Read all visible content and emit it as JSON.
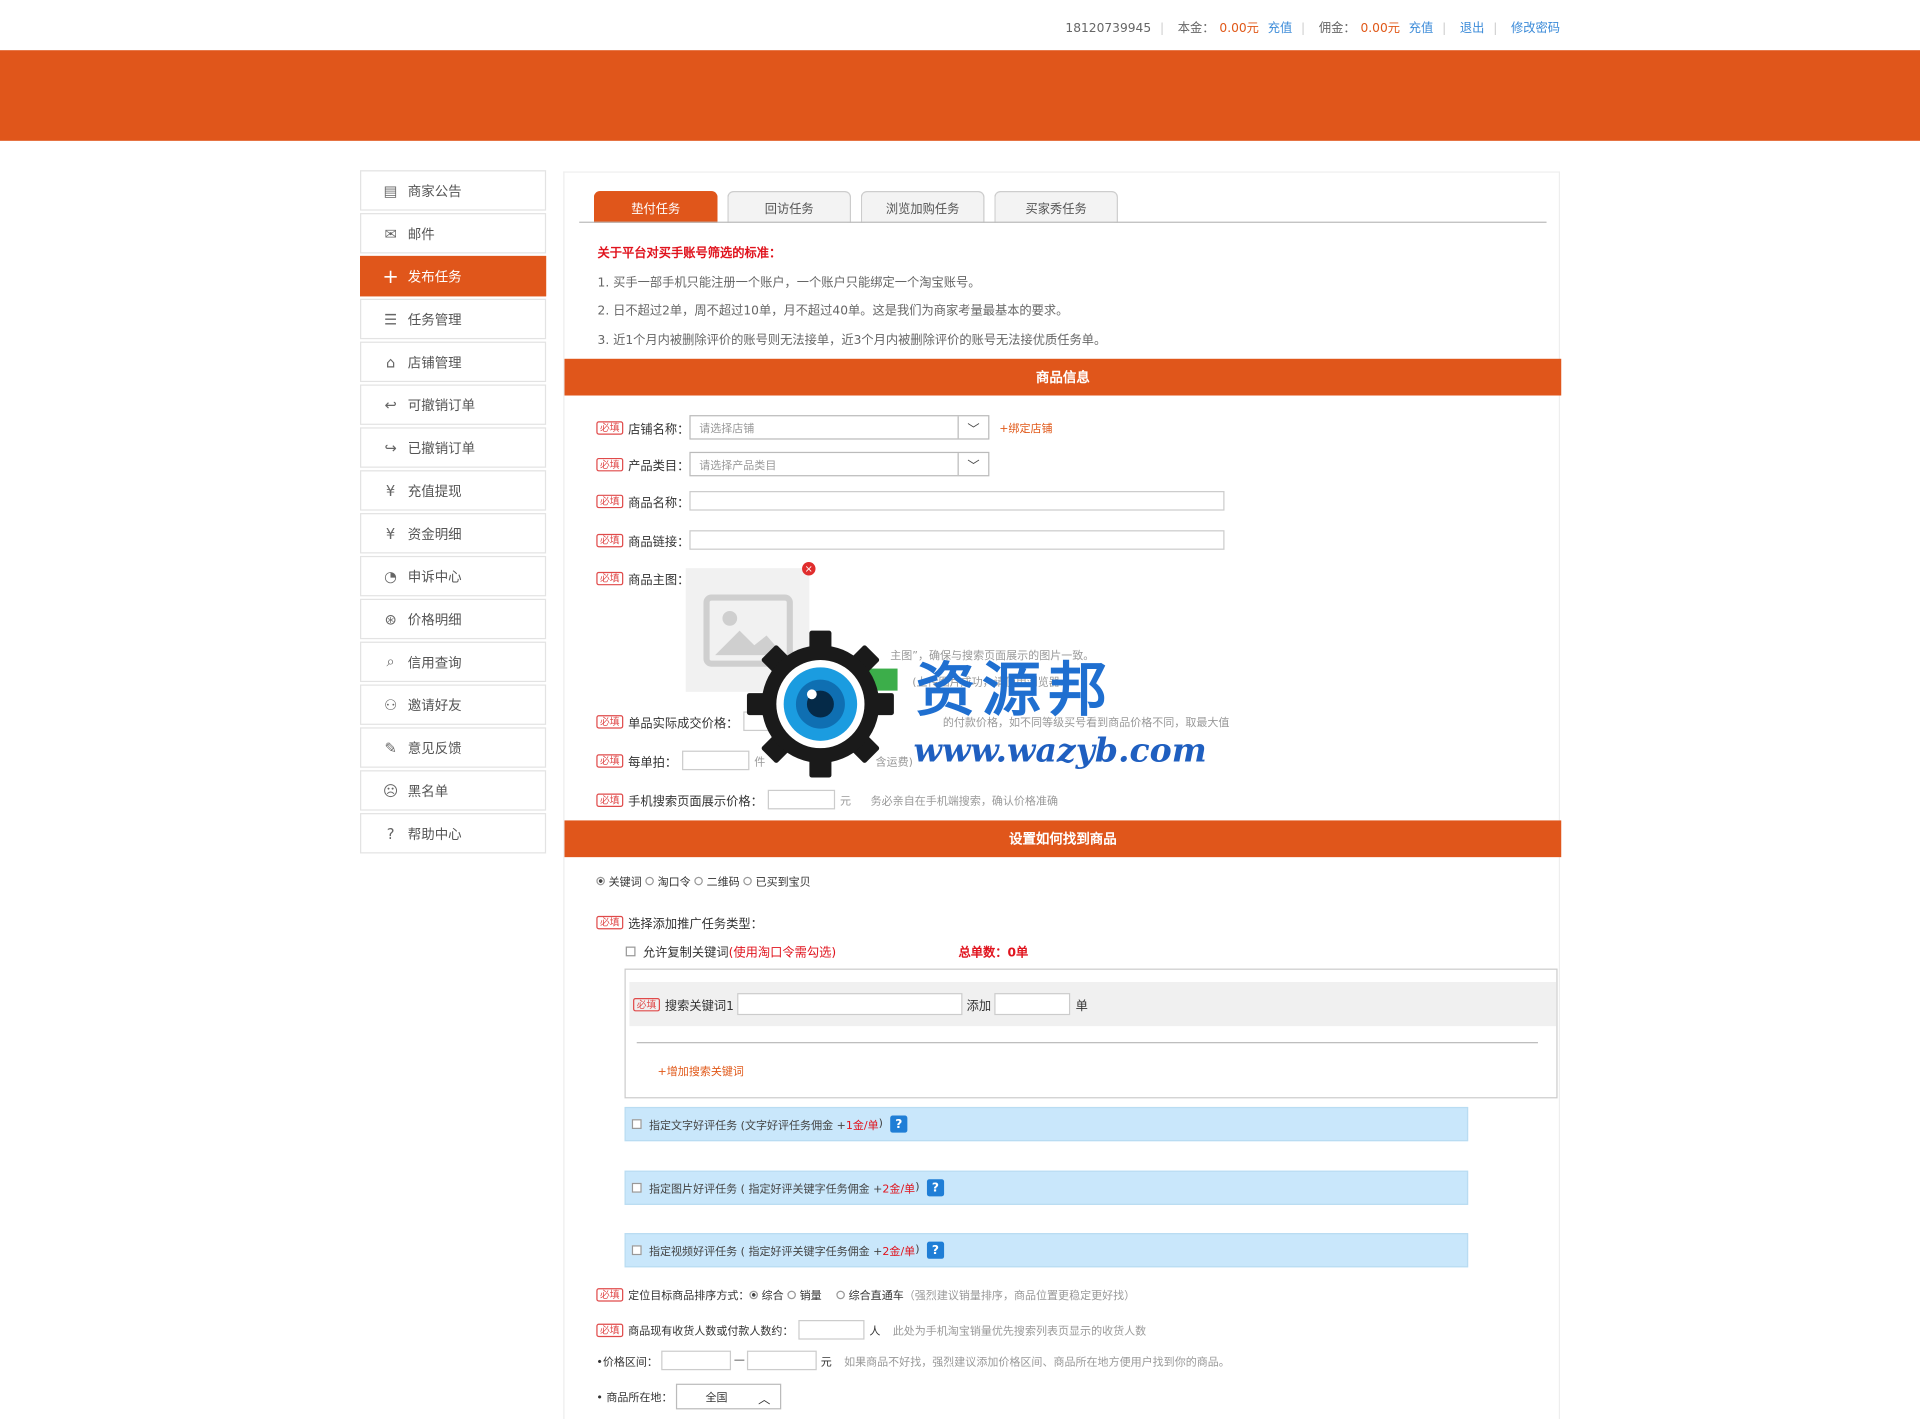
{
  "header": {
    "phone": "18120739945",
    "balance_label": "本金：",
    "balance_value": "0.00元",
    "recharge1": "充值",
    "commission_label": "佣金：",
    "commission_value": "0.00元",
    "recharge2": "充值",
    "logout": "退出",
    "change_password": "修改密码"
  },
  "sidebar": {
    "items": [
      {
        "label": "商家公告",
        "icon": "announcement-icon"
      },
      {
        "label": "邮件",
        "icon": "mail-icon"
      },
      {
        "label": "发布任务",
        "icon": "plus-icon"
      },
      {
        "label": "任务管理",
        "icon": "task-list-icon"
      },
      {
        "label": "店铺管理",
        "icon": "store-icon"
      },
      {
        "label": "可撤销订单",
        "icon": "order-undo-icon"
      },
      {
        "label": "已撤销订单",
        "icon": "order-undone-icon"
      },
      {
        "label": "充值提现",
        "icon": "yen-refresh-icon"
      },
      {
        "label": "资金明细",
        "icon": "yen-icon"
      },
      {
        "label": "申诉中心",
        "icon": "appeal-icon"
      },
      {
        "label": "价格明细",
        "icon": "price-icon"
      },
      {
        "label": "信用查询",
        "icon": "credit-search-icon"
      },
      {
        "label": "邀请好友",
        "icon": "user-icon"
      },
      {
        "label": "意见反馈",
        "icon": "feedback-icon"
      },
      {
        "label": "黑名单",
        "icon": "sad-face-icon"
      },
      {
        "label": "帮助中心",
        "icon": "help-icon"
      }
    ]
  },
  "tabs": [
    "垫付任务",
    "回访任务",
    "浏览加购任务",
    "买家秀任务"
  ],
  "rules": {
    "title": "关于平台对买手账号筛选的标准：",
    "items": [
      "1. 买手一部手机只能注册一个账户，一个账户只能绑定一个淘宝账号。",
      "2. 日不超过2单，周不超过10单，月不超过40单。这是我们为商家考量最基本的要求。",
      "3. 近1个月内被删除评价的账号则无法接单，近3个月内被删除评价的账号无法接优质任务单。"
    ]
  },
  "product": {
    "section_title": "商品信息",
    "required_tag": "必填",
    "store_label": "店铺名称：",
    "store_placeholder": "请选择店铺",
    "bind_store": "+绑定店铺",
    "category_label": "产品类目：",
    "category_placeholder": "请选择产品类目",
    "name_label": "商品名称：",
    "link_label": "商品链接：",
    "image_label": "商品主图：",
    "image_hint": "主图”，确保与搜索页面展示的图片一致。",
    "upload_hint": "(上传图片成功，请使用浏览器...",
    "price_label": "单品实际成交价格：",
    "price_hint": "的付款价格，如不同等级买号看到商品价格不同，取最大值",
    "qty_label": "每单拍：",
    "qty_unit": "件",
    "qty_hint": "含运费)",
    "show_price_label": "手机搜索页面展示价格：",
    "show_price_unit": "元",
    "show_price_hint": "务必亲自在手机端搜索，确认价格准确"
  },
  "find": {
    "section_title": "设置如何找到商品",
    "methods": [
      "关键词",
      "淘口令",
      "二维码",
      "已买到宝贝"
    ],
    "promo_label": "选择添加推广任务类型：",
    "copy_keyword": "允许复制关键词",
    "copy_keyword_note": "(使用淘口令需勾选)",
    "total_orders": "总单数：0单",
    "keyword_label": "搜索关键词1",
    "add_label": "添加",
    "order_unit": "单",
    "add_keyword": "+增加搜索关键词",
    "review_text": "指定文字好评任务 (文字好评任务佣金 + ",
    "review_text_fee": "1金/单",
    "review_image": "指定图片好评任务 ( 指定好评关键字任务佣金 + ",
    "review_image_fee": "2金/单",
    "review_video": "指定视频好评任务 ( 指定好评关键字任务佣金 + ",
    "review_video_fee": "2金/单",
    "close_paren": " )",
    "sort_label": "定位目标商品排序方式：",
    "sort_options": [
      "综合",
      "销量",
      "综合直通车"
    ],
    "sort_hint": "（强烈建议销量排序，商品位置更稳定更好找）",
    "buyers_label": "商品现有收货人数或付款人数约：",
    "buyers_unit": "人",
    "buyers_hint": "此处为手机淘宝销量优先搜索列表页显示的收货人数",
    "price_range_label": "•价格区间：",
    "price_range_sep": "—",
    "price_range_unit": "元",
    "price_range_hint": "如果商品不好找，强烈建议添加价格区间、商品所在地方便用户找到你的商品。",
    "location_label": "• 商品所在地：",
    "location_value": "全国"
  },
  "watermark": {
    "brand": "资源邦",
    "url": "www.wazyb.com"
  }
}
